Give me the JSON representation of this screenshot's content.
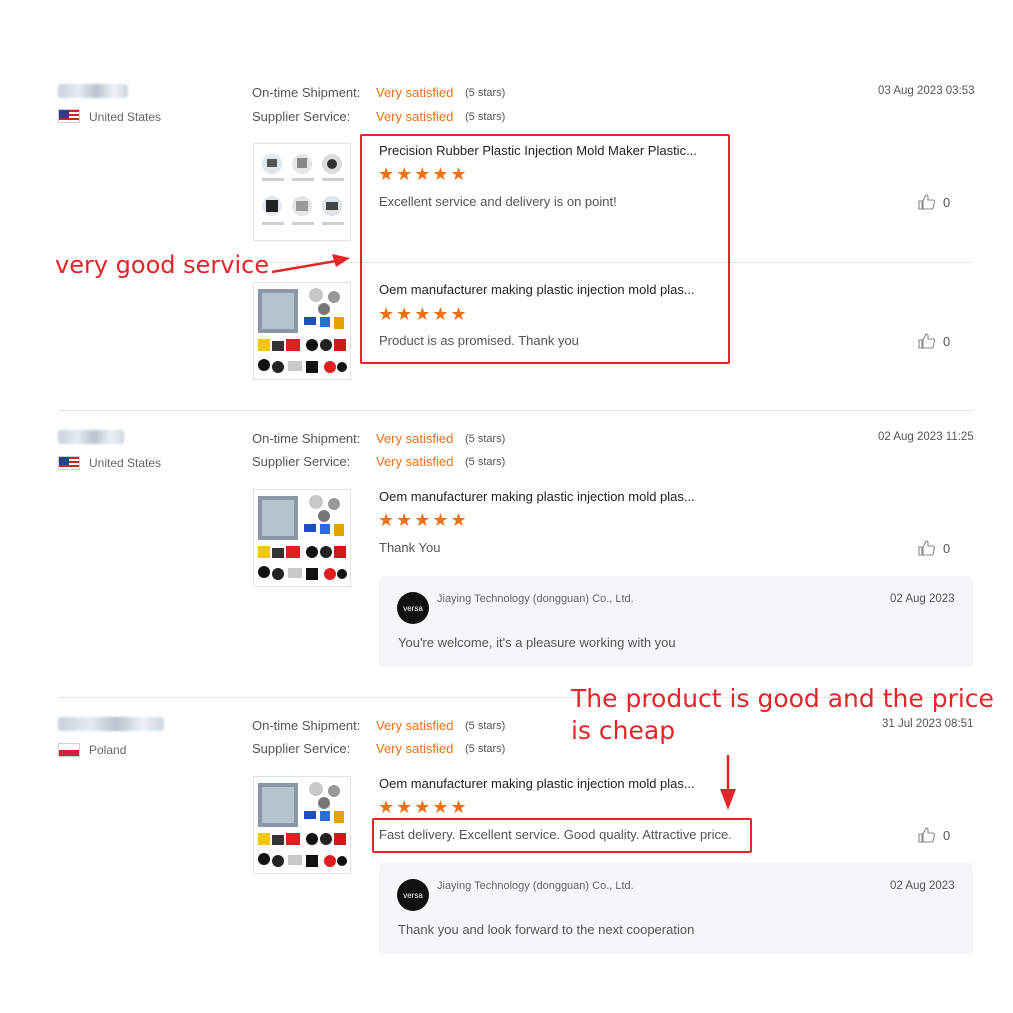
{
  "reviews": [
    {
      "country": "United States",
      "flag": "us",
      "ontime_label": "On-time Shipment:",
      "ontime_value": "Very satisfied",
      "ontime_stars": "(5 stars)",
      "service_label": "Supplier Service:",
      "service_value": "Very satisfied",
      "service_stars": "(5 stars)",
      "date": "03 Aug 2023 03:53",
      "items": [
        {
          "title": "Precision Rubber Plastic Injection Mold Maker Plastic...",
          "stars": "★★★★★",
          "text": "Excellent service and delivery is on point!",
          "likes": "0"
        },
        {
          "title": "Oem manufacturer making plastic injection mold plas...",
          "stars": "★★★★★",
          "text": "Product is as promised. Thank you",
          "likes": "0"
        }
      ]
    },
    {
      "country": "United States",
      "flag": "us",
      "ontime_label": "On-time Shipment:",
      "ontime_value": "Very satisfied",
      "ontime_stars": "(5 stars)",
      "service_label": "Supplier Service:",
      "service_value": "Very satisfied",
      "service_stars": "(5 stars)",
      "date": "02 Aug 2023 11:25",
      "items": [
        {
          "title": "Oem manufacturer making plastic injection mold plas...",
          "stars": "★★★★★",
          "text": "Thank You",
          "likes": "0"
        }
      ],
      "reply": {
        "logo": "versa",
        "company": "Jiaying Technology (dongguan) Co., Ltd.",
        "date": "02 Aug 2023",
        "text": "You're welcome, it's a pleasure working with you"
      }
    },
    {
      "country": "Poland",
      "flag": "pl",
      "ontime_label": "On-time Shipment:",
      "ontime_value": "Very satisfied",
      "ontime_stars": "(5 stars)",
      "service_label": "Supplier Service:",
      "service_value": "Very satisfied",
      "service_stars": "(5 stars)",
      "date": "31 Jul 2023 08:51",
      "items": [
        {
          "title": "Oem manufacturer making plastic injection mold plas...",
          "stars": "★★★★★",
          "text": "Fast delivery. Excellent service. Good quality. Attractive price.",
          "likes": "0"
        }
      ],
      "reply": {
        "logo": "versa",
        "company": "Jiaying Technology (dongguan) Co., Ltd.",
        "date": "02 Aug 2023",
        "text": "Thank you and look forward to the next cooperation"
      }
    }
  ],
  "annotations": {
    "service": "very good service",
    "product_line1": "The product is good and the price",
    "product_line2": "is cheap"
  },
  "colors": {
    "accent": "#f07014",
    "annotation": "#e4262a"
  }
}
